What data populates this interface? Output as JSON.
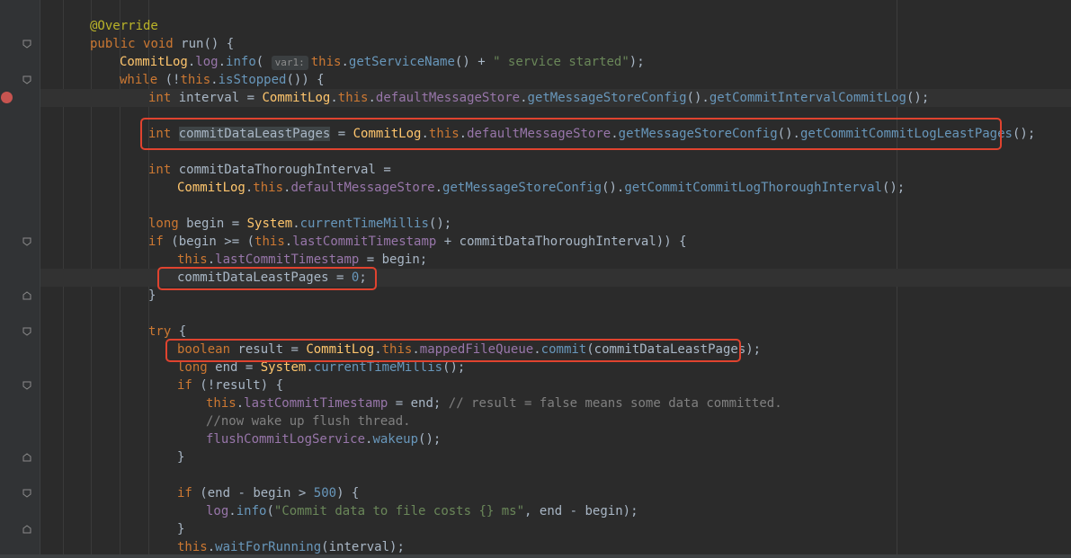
{
  "editor": {
    "annotation": "@Override",
    "kw_public": "public",
    "kw_void": "void",
    "run_sig": " run() {",
    "commitlog_cls": "CommitLog",
    "log_fld": "log",
    "info_m": "info",
    "param_hint": "var1:",
    "this_kw": "this",
    "get_service_name": "getServiceName",
    "str_service_started": "\" service started\"",
    "kw_while": "while",
    "is_stopped": "isStopped",
    "kw_int": "int",
    "var_interval": "interval",
    "default_message_store": "defaultMessageStore",
    "get_message_store_config": "getMessageStoreConfig",
    "get_commit_interval_commit_log": "getCommitIntervalCommitLog",
    "var_commit_data_least_pages": "commitDataLeastPages",
    "get_commit_commit_log_least_pages": "getCommitCommitLogLeastPages",
    "var_commit_data_thorough_interval": "commitDataThoroughInterval",
    "get_commit_commit_log_thorough_interval": "getCommitCommitLogThoroughInterval",
    "kw_long": "long",
    "var_begin": "begin",
    "system_cls": "System",
    "current_time_millis": "currentTimeMillis",
    "kw_if": "if",
    "last_commit_timestamp": "lastCommitTimestamp",
    "num_zero": "0",
    "kw_try": "try",
    "kw_boolean": "boolean",
    "var_result": "result",
    "mapped_file_queue": "mappedFileQueue",
    "commit_m": "commit",
    "var_end": "end",
    "comment_result": "// result = false means some data committed.",
    "comment_wake": "//now wake up flush thread.",
    "flush_commit_log_service": "flushCommitLogService",
    "wakeup_m": "wakeup",
    "num_500": "500",
    "str_commit_costs": "\"Commit data to file costs {} ms\"",
    "wait_for_running": "waitForRunning"
  }
}
